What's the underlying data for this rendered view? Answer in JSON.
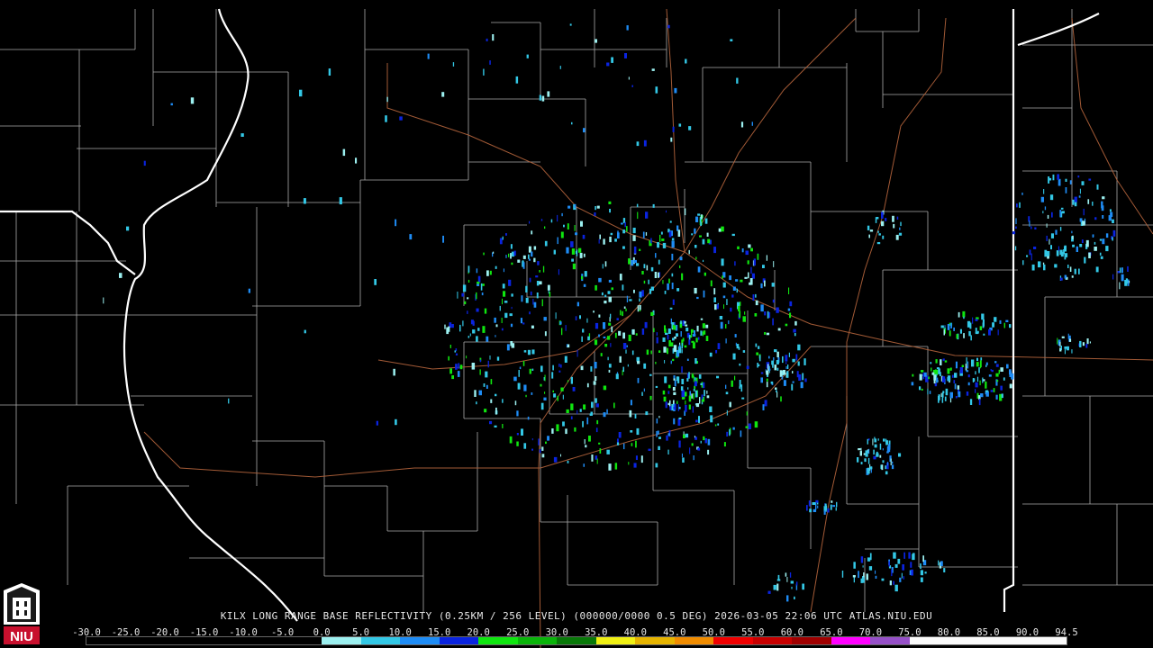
{
  "caption": "KILX LONG RANGE BASE REFLECTIVITY (0.25KM / 256 LEVEL) (000000/0000 0.5 DEG) 2026-03-05 22:06 UTC  ATLAS.NIU.EDU",
  "logo_text": "NIU",
  "scale": {
    "labels": [
      "-30.0",
      "-25.0",
      "-20.0",
      "-15.0",
      "-10.0",
      "-5.0",
      "0.0",
      "5.0",
      "10.0",
      "15.0",
      "20.0",
      "25.0",
      "30.0",
      "35.0",
      "40.0",
      "45.0",
      "50.0",
      "55.0",
      "60.0",
      "65.0",
      "70.0",
      "75.0",
      "80.0",
      "85.0",
      "90.0",
      "94.5"
    ],
    "colors": [
      "#000000",
      "#000000",
      "#000000",
      "#000000",
      "#000000",
      "#000000",
      "#9cf0f0",
      "#33c8e6",
      "#1e8cf5",
      "#0a24e0",
      "#0fe60f",
      "#0ab40a",
      "#087808",
      "#f0f014",
      "#e6b400",
      "#f08c00",
      "#f00000",
      "#c80000",
      "#a00000",
      "#ff00ff",
      "#9650c8",
      "#fafafa",
      "#fafafa",
      "#fafafa",
      "#fafafa"
    ]
  },
  "map_colors": {
    "background": "#000000",
    "county_lines": "#c8c8c8",
    "state_lines": "#ffffff",
    "highways": "#b4643c"
  },
  "radar_site": "KILX"
}
